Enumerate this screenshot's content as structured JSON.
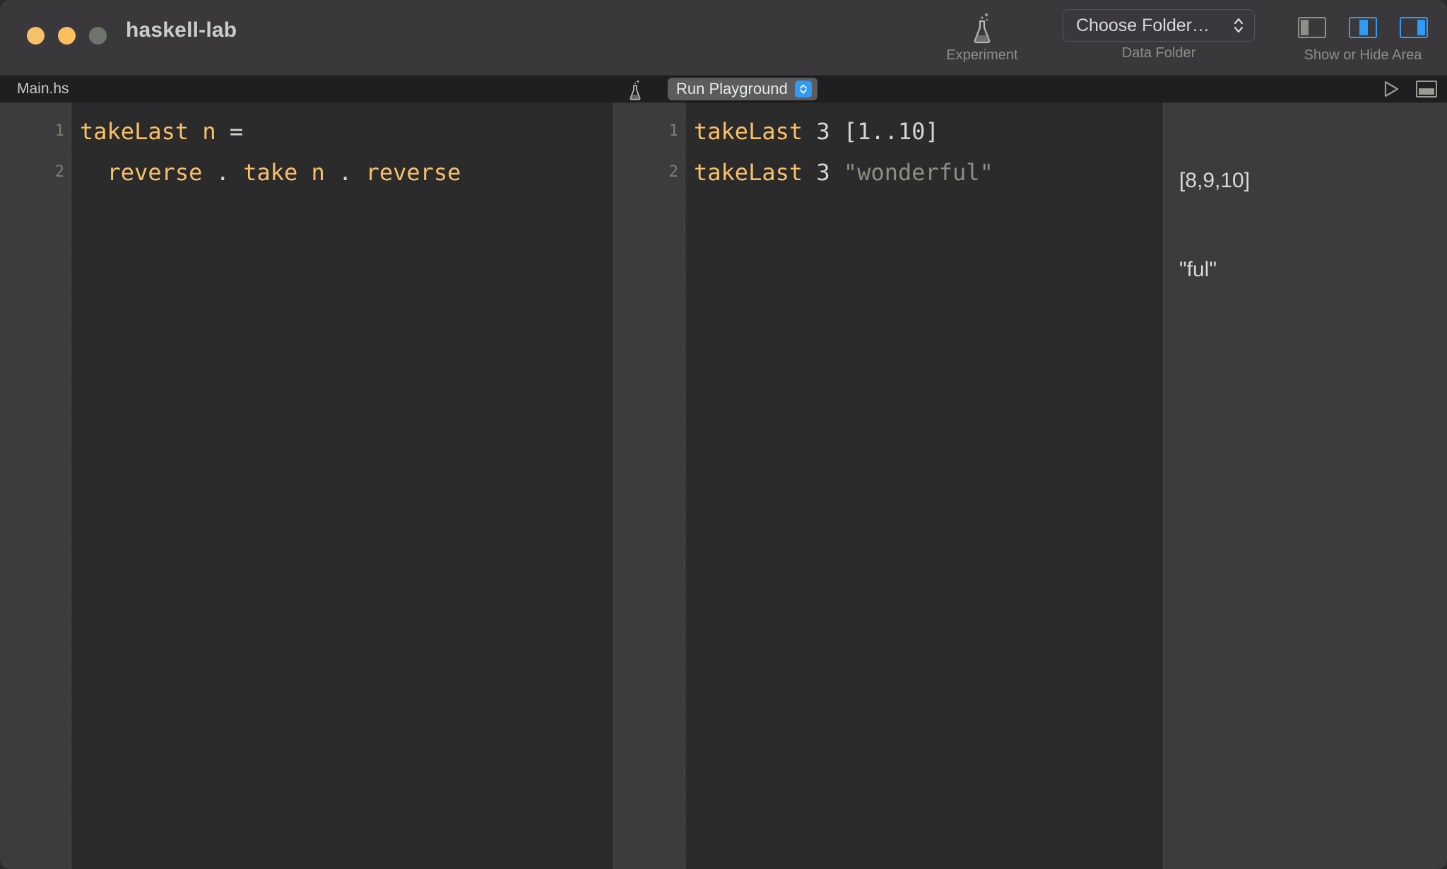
{
  "window": {
    "title": "haskell-lab",
    "traffic_lights": [
      {
        "name": "close",
        "color": "#f7c06a"
      },
      {
        "name": "minimize",
        "color": "#fbbf62"
      },
      {
        "name": "zoom",
        "color": "#6f756c"
      }
    ]
  },
  "toolbar": {
    "experiment": {
      "label": "Experiment",
      "icon": "flask-icon"
    },
    "data_folder": {
      "label": "Data Folder",
      "selected": "Choose Folder…",
      "icon": "chevron-updown-icon"
    },
    "show_hide_area": {
      "label": "Show or Hide Area",
      "toggles": [
        {
          "name": "left-panel",
          "active": false
        },
        {
          "name": "center-panel",
          "active": true
        },
        {
          "name": "right-panel",
          "active": true
        }
      ]
    },
    "accent_color": "#2f9bf7",
    "icon_color": "#8e8f88"
  },
  "tabbar": {
    "file_tab": "Main.hs",
    "flask_icon": "flask-icon",
    "run_playground": {
      "label": "Run Playground",
      "stepper_icon": "chevron-updown-icon"
    },
    "run_icon": "play-triangle-icon",
    "console_icon": "console-panel-icon"
  },
  "editor": {
    "line_numbers": [
      "1",
      "2"
    ],
    "lines": [
      [
        {
          "text": "takeLast n",
          "type": "fn"
        },
        {
          "text": " ",
          "type": "plain"
        },
        {
          "text": "=",
          "type": "op"
        }
      ],
      [
        {
          "text": "  ",
          "type": "plain"
        },
        {
          "text": "reverse",
          "type": "fn"
        },
        {
          "text": " ",
          "type": "plain"
        },
        {
          "text": ".",
          "type": "op"
        },
        {
          "text": " ",
          "type": "plain"
        },
        {
          "text": "take n",
          "type": "fn"
        },
        {
          "text": " ",
          "type": "plain"
        },
        {
          "text": ".",
          "type": "op"
        },
        {
          "text": " ",
          "type": "plain"
        },
        {
          "text": "reverse",
          "type": "fn"
        }
      ]
    ]
  },
  "playground": {
    "line_numbers": [
      "1",
      "2"
    ],
    "lines": [
      [
        {
          "text": "takeLast",
          "type": "fn"
        },
        {
          "text": " ",
          "type": "plain"
        },
        {
          "text": "3",
          "type": "num"
        },
        {
          "text": " ",
          "type": "plain"
        },
        {
          "text": "[1..10]",
          "type": "op"
        }
      ],
      [
        {
          "text": "takeLast",
          "type": "fn"
        },
        {
          "text": " ",
          "type": "plain"
        },
        {
          "text": "3",
          "type": "num"
        },
        {
          "text": " ",
          "type": "plain"
        },
        {
          "text": "\"wonderful\"",
          "type": "str"
        }
      ]
    ]
  },
  "results": {
    "lines": [
      "[8,9,10]",
      "\"ful\""
    ]
  },
  "colors": {
    "titlebar_bg": "#3a383a",
    "tabbar_bg": "#1f1f21",
    "code_bg": "#2b2b2b",
    "gutter_bg": "#3c3c3c",
    "results_bg": "#3c3c3c",
    "identifier": "#f9c06a",
    "operator": "#d2d6db",
    "string": "#8b9083",
    "line_number": "#7c8070"
  }
}
